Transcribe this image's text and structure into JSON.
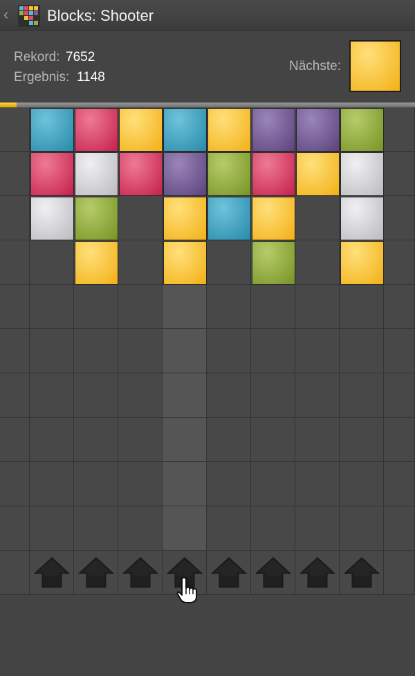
{
  "app": {
    "title": "Blocks: Shooter",
    "back_icon": "chevron-left-icon",
    "app_icon": "blocks-grid-icon"
  },
  "score": {
    "record_label": "Rekord:",
    "record_value": "7652",
    "result_label": "Ergebnis:",
    "result_value": "1148",
    "next_label": "Nächste:",
    "next_color": "yellow"
  },
  "progress": {
    "fraction": 0.04
  },
  "colors": {
    "blue": [
      "#6ec3da",
      "#2b8cac"
    ],
    "red": [
      "#ee7a96",
      "#c7234f"
    ],
    "yellow": [
      "#ffe07a",
      "#f3b21a"
    ],
    "purple": [
      "#9a85b8",
      "#5e457f"
    ],
    "green": [
      "#b6cc6a",
      "#7a9627"
    ],
    "white": [
      "#f0f0f2",
      "#bdbdc2"
    ]
  },
  "board": {
    "columns": 8,
    "rows": 10,
    "highlight_column": 3,
    "blocks": [
      [
        "blue",
        "red",
        "yellow",
        "blue",
        "yellow",
        "purple",
        "purple",
        "green"
      ],
      [
        "red",
        "white",
        "red",
        "purple",
        "green",
        "red",
        "yellow",
        "white"
      ],
      [
        "white",
        "green",
        null,
        "yellow",
        "blue",
        "yellow",
        null,
        "white"
      ],
      [
        null,
        "yellow",
        null,
        "yellow",
        null,
        "green",
        null,
        "yellow"
      ]
    ],
    "shoot_arrows": [
      "arrow-up-icon",
      "arrow-up-icon",
      "arrow-up-icon",
      "arrow-up-icon",
      "arrow-up-icon",
      "arrow-up-icon",
      "arrow-up-icon",
      "arrow-up-icon"
    ]
  },
  "cursor": {
    "icon": "hand-pointer-icon",
    "column": 3
  }
}
